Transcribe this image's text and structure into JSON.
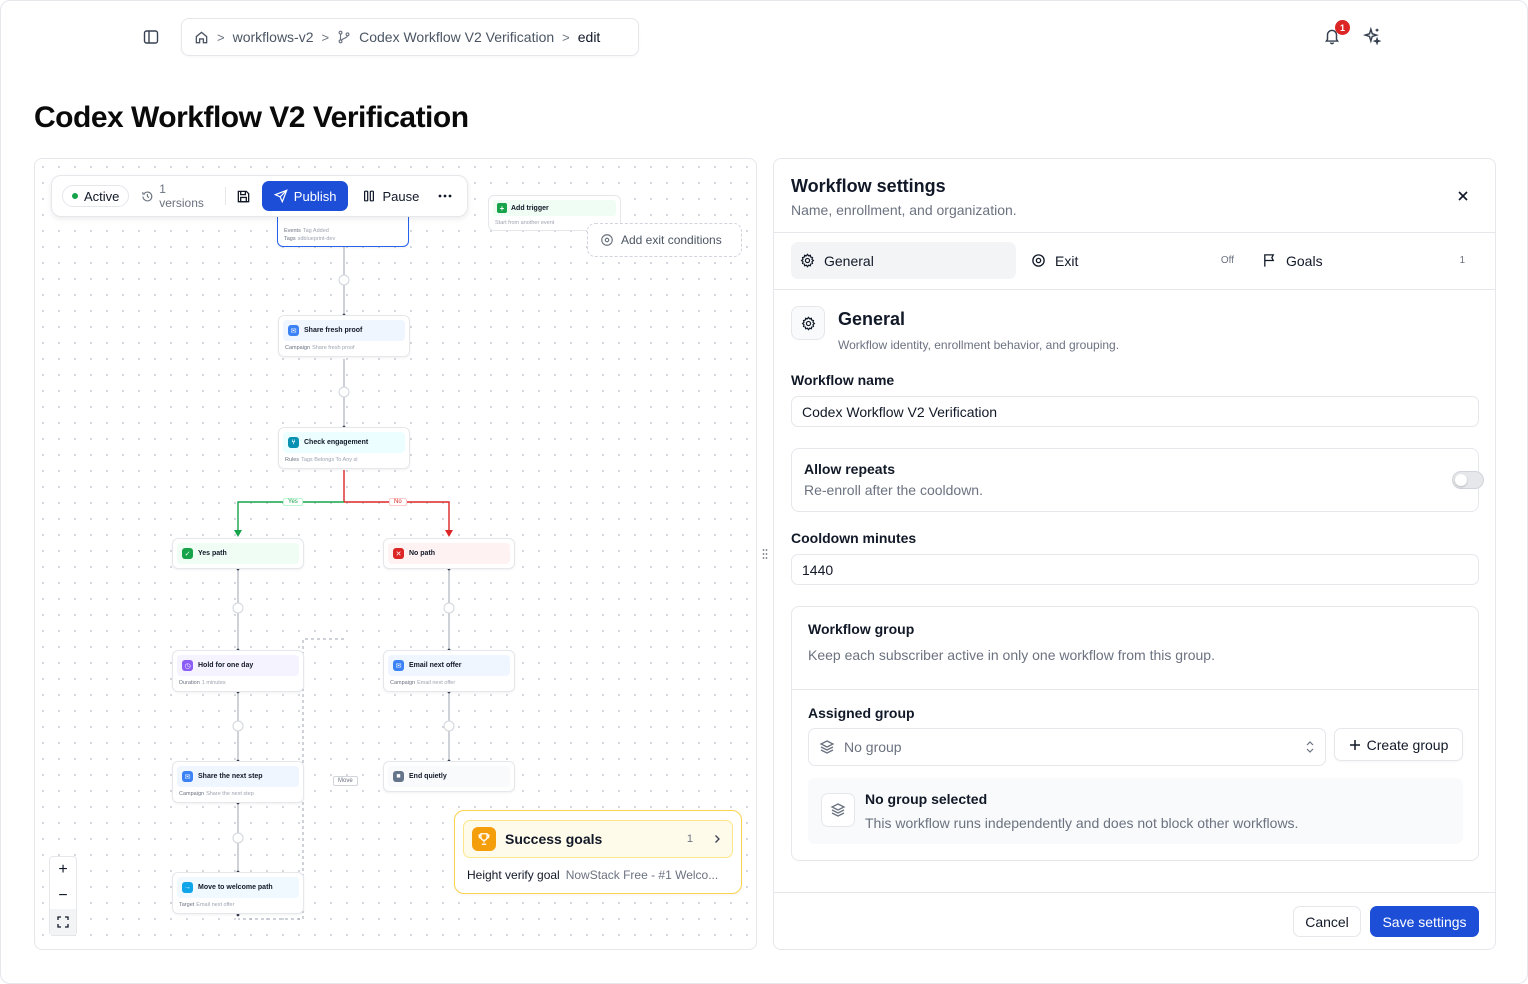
{
  "breadcrumb": {
    "items": [
      "workflows-v2",
      "Codex Workflow V2 Verification",
      "edit"
    ]
  },
  "notifications": {
    "count": "1"
  },
  "page": {
    "title": "Codex Workflow V2 Verification"
  },
  "toolbar": {
    "status": "Active",
    "versions": "1 versions",
    "publish_label": "Publish",
    "pause_label": "Pause"
  },
  "canvas": {
    "trigger_node": {
      "sub_label": "Events",
      "sub_value": "Tag Added",
      "sub2_label": "Tags",
      "sub2_value": "sdblueprint-dev"
    },
    "add_trigger": {
      "title": "Add trigger",
      "sub": "Start from another event"
    },
    "exit_conditions_label": "Add exit conditions",
    "nodes": [
      {
        "title": "Share fresh proof",
        "sub_label": "Campaign",
        "sub_value": "Share fresh proof"
      },
      {
        "title": "Check engagement",
        "sub_label": "Rules",
        "sub_value": "Tags Belongs To Any sl"
      },
      {
        "title": "Yes path",
        "sub_label": "",
        "sub_value": ""
      },
      {
        "title": "No path",
        "sub_label": "",
        "sub_value": ""
      },
      {
        "title": "Hold for one day",
        "sub_label": "Duration",
        "sub_value": "1 minutes"
      },
      {
        "title": "Email next offer",
        "sub_label": "Campaign",
        "sub_value": "Email next offer"
      },
      {
        "title": "Share the next step",
        "sub_label": "Campaign",
        "sub_value": "Share the next step"
      },
      {
        "title": "End quietly",
        "sub_label": "",
        "sub_value": ""
      },
      {
        "title": "Move to welcome path",
        "sub_label": "Target",
        "sub_value": "Email next offer"
      }
    ],
    "branch_yes": "Yes",
    "branch_no": "No",
    "move_label": "Move",
    "goals": {
      "title": "Success goals",
      "count": "1",
      "goal_name": "Height verify goal",
      "goal_desc": "NowStack Free - #1 Welco..."
    },
    "colors": {
      "yes": "#16a34a",
      "no": "#dc2626",
      "accent": "#1d4ed8",
      "goal": "#f59e0b"
    }
  },
  "settings": {
    "title": "Workflow settings",
    "subtitle": "Name, enrollment, and organization.",
    "tabs": [
      {
        "label": "General",
        "count": ""
      },
      {
        "label": "Exit",
        "count": "Off"
      },
      {
        "label": "Goals",
        "count": "1"
      }
    ],
    "section_title": "General",
    "section_subtitle": "Workflow identity, enrollment behavior, and grouping.",
    "name_label": "Workflow name",
    "name_value": "Codex Workflow V2 Verification",
    "repeats_title": "Allow repeats",
    "repeats_desc": "Re-enroll after the cooldown.",
    "cooldown_label": "Cooldown minutes",
    "cooldown_value": "1440",
    "group_title": "Workflow group",
    "group_desc": "Keep each subscriber active in only one workflow from this group.",
    "assigned_label": "Assigned group",
    "assigned_value": "No group",
    "create_group_label": "Create group",
    "empty_title": "No group selected",
    "empty_desc": "This workflow runs independently and does not block other workflows.",
    "cancel_label": "Cancel",
    "save_label": "Save settings"
  }
}
